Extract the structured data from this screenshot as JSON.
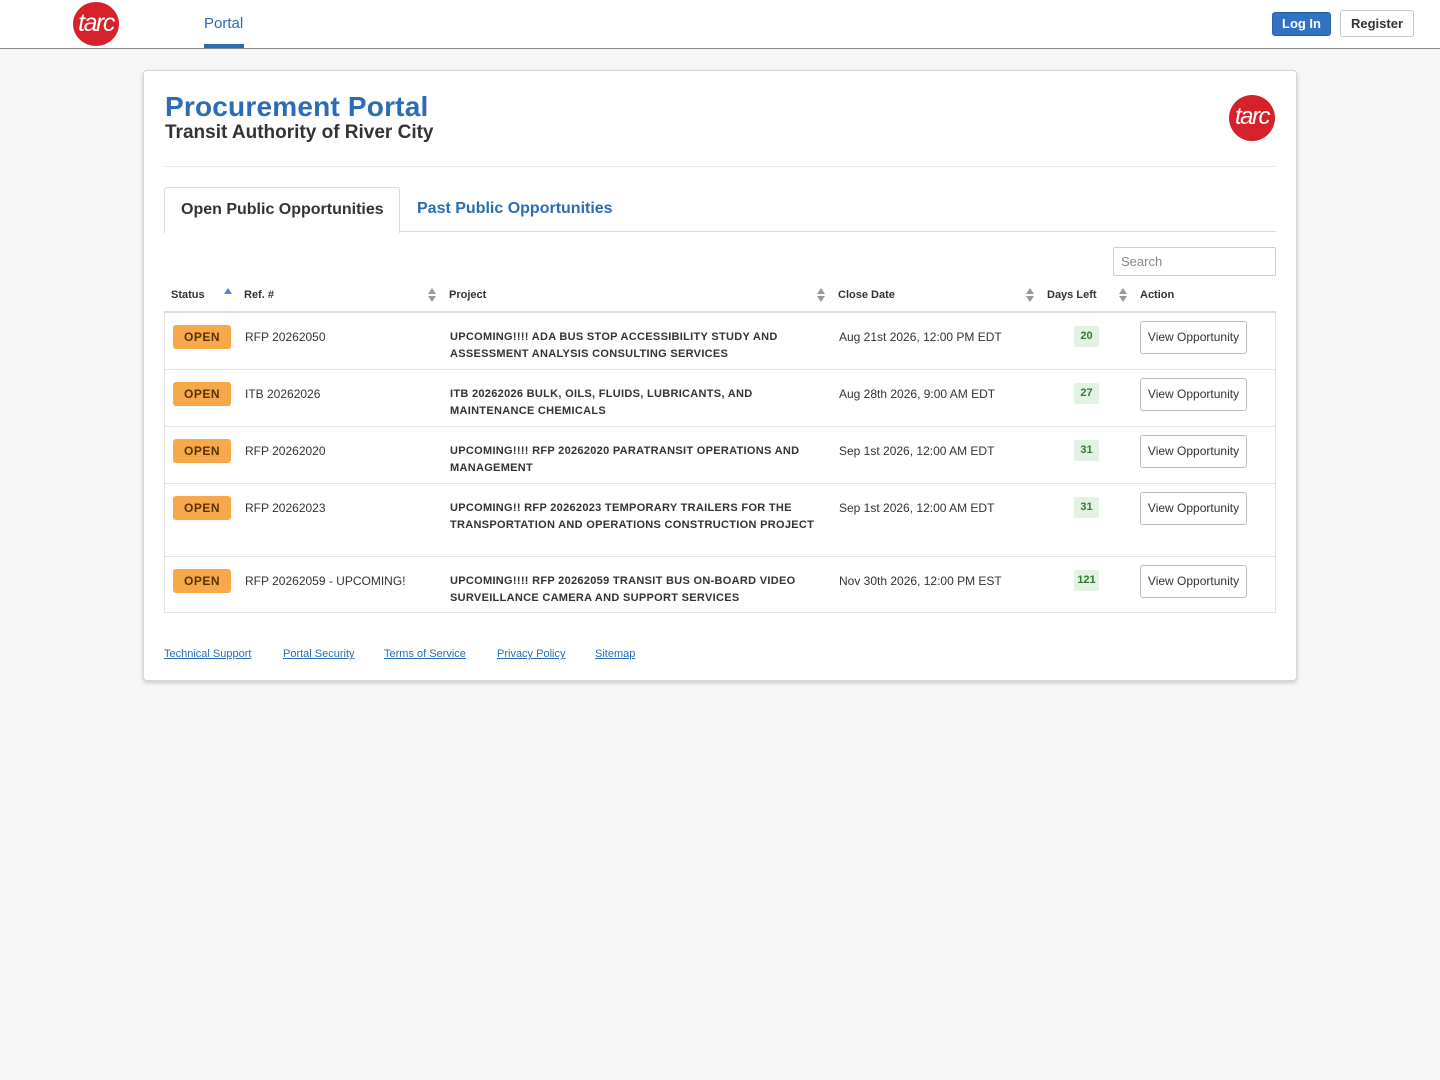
{
  "nav": {
    "logo_text": "tarc",
    "portal_tab": "Portal",
    "login_label": "Log In",
    "register_label": "Register"
  },
  "header": {
    "title": "Procurement Portal",
    "subtitle": "Transit Authority of River City",
    "logo_text": "tarc"
  },
  "tabs": {
    "open": "Open Public Opportunities",
    "past": "Past Public Opportunities"
  },
  "search": {
    "placeholder": "Search"
  },
  "table": {
    "columns": [
      "Status",
      "Ref. #",
      "Project",
      "Close Date",
      "Days Left",
      "Action"
    ],
    "rows": [
      {
        "status": "OPEN",
        "ref": "RFP 20262050",
        "project": "UPCOMING!!!! ADA BUS STOP ACCESSIBILITY STUDY AND ASSESSMENT ANALYSIS CONSULTING SERVICES",
        "close_date": "Aug 21st 2026, 12:00 PM EDT",
        "days_left": "20",
        "action": "View Opportunity"
      },
      {
        "status": "OPEN",
        "ref": "ITB 20262026",
        "project": "ITB 20262026 BULK, OILS, FLUIDS, LUBRICANTS, AND MAINTENANCE CHEMICALS",
        "close_date": "Aug 28th 2026, 9:00 AM EDT",
        "days_left": "27",
        "action": "View Opportunity"
      },
      {
        "status": "OPEN",
        "ref": "RFP 20262020",
        "project": "UPCOMING!!!! RFP 20262020 PARATRANSIT OPERATIONS AND MANAGEMENT",
        "close_date": "Sep 1st 2026, 12:00 AM EDT",
        "days_left": "31",
        "action": "View Opportunity"
      },
      {
        "status": "OPEN",
        "ref": "RFP 20262023",
        "project": "UPCOMING!! RFP 20262023 TEMPORARY TRAILERS FOR THE TRANSPORTATION AND OPERATIONS CONSTRUCTION PROJECT",
        "close_date": "Sep 1st 2026, 12:00 AM EDT",
        "days_left": "31",
        "action": "View Opportunity"
      },
      {
        "status": "OPEN",
        "ref": "RFP 20262059 - UPCOMING!",
        "project": "UPCOMING!!!! RFP 20262059 TRANSIT BUS ON-BOARD VIDEO SURVEILLANCE CAMERA AND SUPPORT SERVICES",
        "close_date": "Nov 30th 2026, 12:00 PM EST",
        "days_left": "121",
        "action": "View Opportunity"
      }
    ]
  },
  "footer": {
    "links": [
      "Technical Support",
      "Portal Security",
      "Terms of Service",
      "Privacy Policy",
      "Sitemap"
    ]
  },
  "colors": {
    "brand_blue": "#2a6db5",
    "logo_red": "#d6202a",
    "status_open": "#f7a84a",
    "days_badge_bg": "#e3f3e3"
  }
}
